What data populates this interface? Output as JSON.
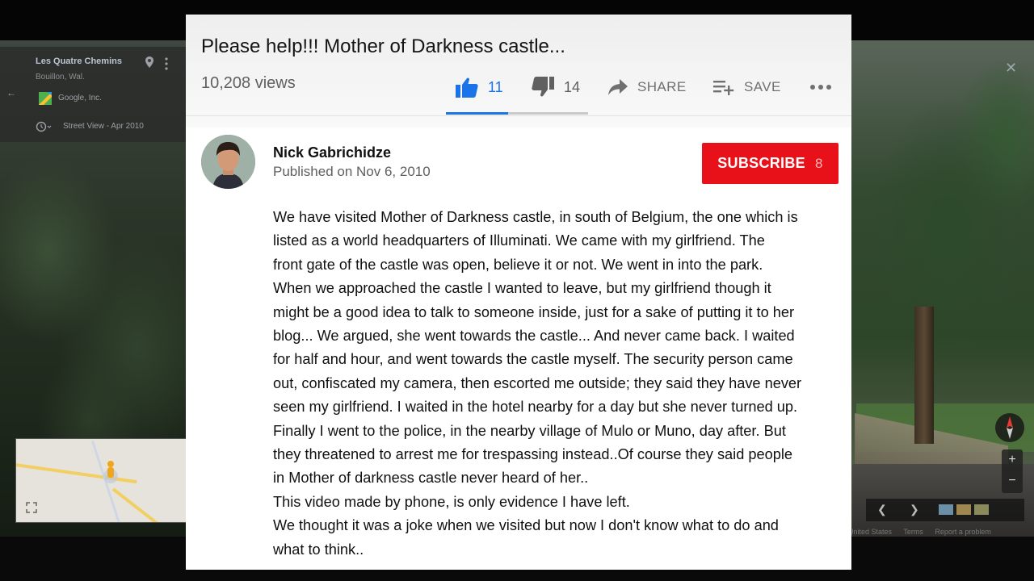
{
  "background": {
    "place_title": "Les Quatre Chemins",
    "place_subtitle": "Bouillon, Wal.",
    "credit": "Google, Inc.",
    "street_view_date": "Street View - Apr 2010",
    "footer_links": [
      "United States",
      "Terms",
      "Report a problem"
    ]
  },
  "video": {
    "title": "Please help!!! Mother of Darkness castle...",
    "views": "10,208 views",
    "likes": "11",
    "dislikes": "14",
    "share_label": "SHARE",
    "save_label": "SAVE",
    "like_ratio": 0.44
  },
  "channel": {
    "name": "Nick Gabrichidze",
    "published": "Published on Nov 6, 2010",
    "subscribe_label": "SUBSCRIBE",
    "subscriber_count": "8"
  },
  "description_lines": [
    "We have visited Mother of Darkness castle, in south of Belgium, the one which is",
    "listed as a world headquarters of Illuminati. We came with my girlfriend. The",
    "front gate of the castle was open, believe it or not. We went in into the park.",
    "When we approached the castle I wanted to leave, but my girlfriend though it",
    "might be a good idea to talk to someone inside, just for a sake of putting it to her",
    "blog... We argued, she went towards the castle... And never came back. I waited",
    "for half and hour, and went towards the castle myself. The security person came",
    "out, confiscated my camera, then escorted me outside; they said they have never",
    "seen my girlfriend. I waited in the hotel  nearby for a day but she never turned up.",
    "Finally I went to the police, in the nearby village of Mulo or Muno, day after. But",
    "they threatened to arrest me for trespassing instead..Of course they said people",
    "in Mother of darkness castle never heard of her..",
    "This video made by phone, is only evidence I have left.",
    "We thought it was a joke when we visited but now I don't know what to do and",
    "what to think.."
  ],
  "colors": {
    "like_blue": "#1a73e8",
    "subscribe_red": "#e8111a",
    "text_gray": "#606060"
  }
}
